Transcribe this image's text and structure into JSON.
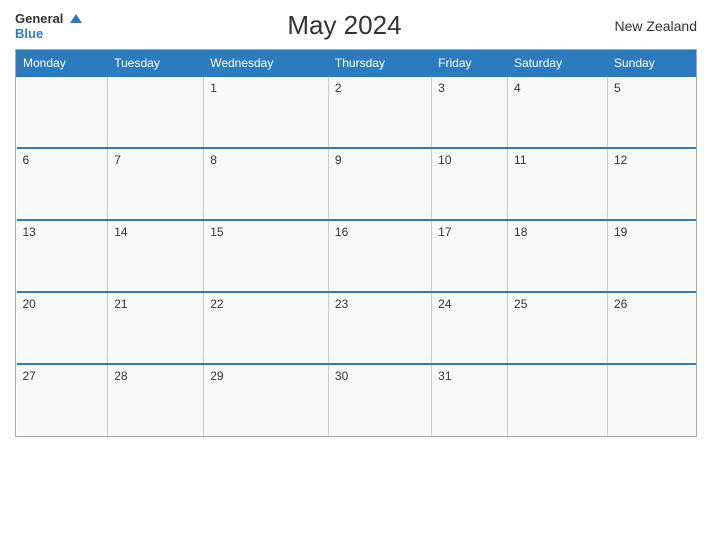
{
  "logo": {
    "general": "General",
    "blue": "Blue"
  },
  "title": "May 2024",
  "country": "New Zealand",
  "days_of_week": [
    "Monday",
    "Tuesday",
    "Wednesday",
    "Thursday",
    "Friday",
    "Saturday",
    "Sunday"
  ],
  "weeks": [
    [
      "",
      "",
      "1",
      "2",
      "3",
      "4",
      "5"
    ],
    [
      "6",
      "7",
      "8",
      "9",
      "10",
      "11",
      "12"
    ],
    [
      "13",
      "14",
      "15",
      "16",
      "17",
      "18",
      "19"
    ],
    [
      "20",
      "21",
      "22",
      "23",
      "24",
      "25",
      "26"
    ],
    [
      "27",
      "28",
      "29",
      "30",
      "31",
      "",
      ""
    ]
  ]
}
